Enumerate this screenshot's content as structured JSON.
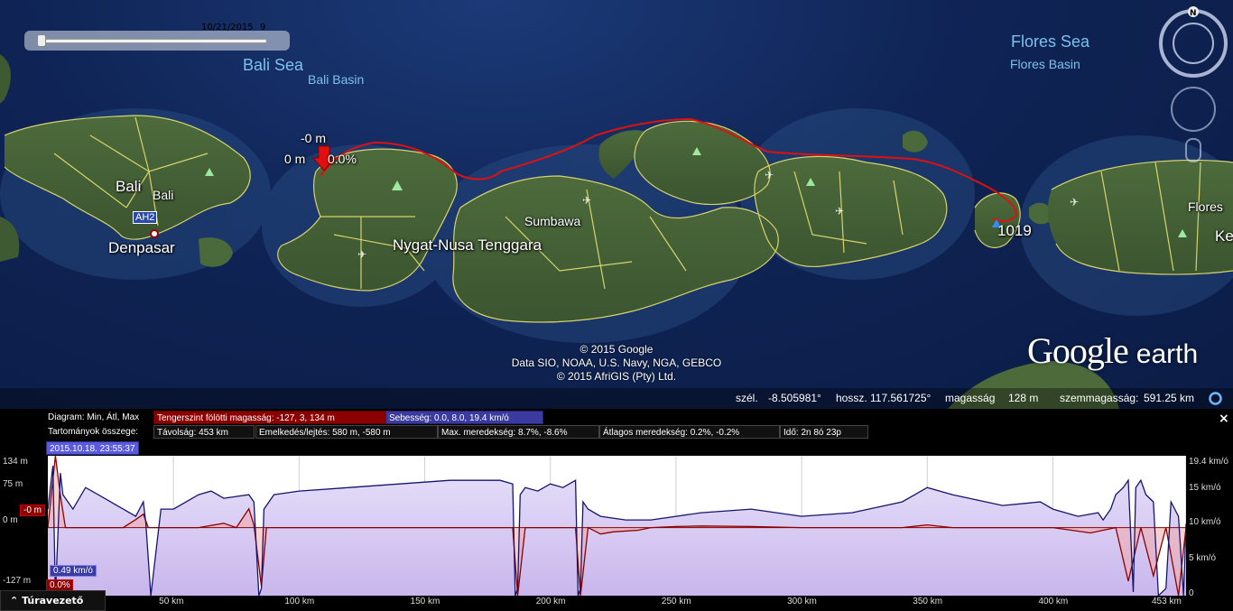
{
  "time_slider": {
    "date": "10/21/2015",
    "value": "9"
  },
  "map_labels": {
    "bali_sea": "Bali Sea",
    "bali_basin": "Bali Basin",
    "flores_sea": "Flores Sea",
    "flores_basin": "Flores Basin",
    "bali_island": "Bali",
    "bali_region": "Bali",
    "ah2": "AH2",
    "denpasar": "Denpasar",
    "sumbawa": "Sumbawa",
    "nygat": "Nygat-Nusa Tenggara",
    "flores": "Flores",
    "ke": "Ke",
    "marker_alt": "-0 m",
    "marker_left": "0 m",
    "marker_pct": "0.0%",
    "end_value": "1019"
  },
  "credits": {
    "line1": "© 2015 Google",
    "line2": "Data SIO, NOAA, U.S. Navy, NGA, GEBCO",
    "line3": "© 2015 AfriGIS (Pty) Ltd."
  },
  "logo": {
    "google": "Google",
    "earth": "earth"
  },
  "status": {
    "lat_label": "szél.",
    "lat": "-8.505981°",
    "lon_label": "hossz.",
    "lon": "117.561725°",
    "elev_label": "magasság",
    "elev": "128 m",
    "eye_label": "szemmagasság:",
    "eye": "591.25 km"
  },
  "profile": {
    "diagram_label": "Diagram: Min, Átl, Max",
    "altitude_stats": "Tengerszint fölötti magasság: -127, 3, 134 m",
    "speed_stats": "Sebesség: 0.0, 8.0, 19.4 km/ó",
    "range_label": "Tartományok összege:",
    "distance": "Távolság: 453 km",
    "gain_loss": "Emelkedés/lejtés: 580 m, -580 m",
    "max_slope": "Max. meredekség: 8.7%, -8.6%",
    "avg_slope": "Átlagos meredekség: 0.2%, -0.2%",
    "duration": "Idő: 2n 8ó 23p",
    "cursor_date": "2015.10.18. 23:55:37",
    "close": "×",
    "y_left": [
      "134 m",
      "75 m",
      "0 m",
      "-127 m"
    ],
    "y_left_current": "-0 m",
    "y_right": [
      "19.4 km/ó",
      "15 km/ó",
      "10 km/ó",
      "5 km/ó",
      "0"
    ],
    "speed_current": "0.49 km/ó",
    "slope_current": "0.0%",
    "x_ticks": [
      "50 km",
      "100 km",
      "150 km",
      "200 km",
      "250 km",
      "300 km",
      "350 km",
      "400 km",
      "453 km"
    ],
    "tour_button": "Túravezető"
  },
  "colors": {
    "track": "#e01010",
    "altitude_line": "#8b0000",
    "speed_line": "#15156e",
    "speed_fill": "#c9b6ec"
  },
  "chart_data": {
    "type": "line",
    "x_unit": "km",
    "xlim": [
      0,
      453
    ],
    "x_ticks": [
      50,
      100,
      150,
      200,
      250,
      300,
      350,
      400,
      453
    ],
    "series": [
      {
        "axis": "left",
        "ylim": [
          -127,
          134
        ],
        "x": [
          0,
          3,
          5,
          7,
          10,
          20,
          30,
          35,
          38,
          40,
          50,
          60,
          70,
          75,
          80,
          82,
          85,
          87,
          90,
          100,
          120,
          150,
          180,
          185,
          187,
          190,
          200,
          210,
          212,
          215,
          220,
          225,
          235,
          240,
          250,
          260,
          280,
          300,
          320,
          340,
          350,
          360,
          380,
          400,
          415,
          420,
          425,
          430,
          435,
          440,
          445,
          450,
          453
        ],
        "y": [
          0,
          134,
          60,
          0,
          0,
          0,
          0,
          15,
          25,
          0,
          0,
          0,
          8,
          0,
          35,
          5,
          -110,
          0,
          0,
          0,
          0,
          0,
          0,
          0,
          -127,
          0,
          0,
          0,
          -127,
          0,
          -12,
          -8,
          -5,
          0,
          2,
          3,
          2,
          0,
          0,
          0,
          5,
          0,
          0,
          0,
          -10,
          -5,
          0,
          -100,
          0,
          -90,
          0,
          -127,
          0
        ]
      },
      {
        "axis": "right",
        "ylim": [
          0,
          19.4
        ],
        "x": [
          0,
          2,
          3,
          5,
          6,
          8,
          10,
          15,
          20,
          25,
          30,
          35,
          38,
          39,
          41,
          45,
          50,
          60,
          65,
          70,
          80,
          82,
          84,
          85,
          86,
          88,
          90,
          100,
          120,
          140,
          160,
          180,
          185,
          186,
          187,
          188,
          190,
          195,
          200,
          205,
          210,
          211,
          212,
          213,
          215,
          220,
          230,
          240,
          250,
          260,
          280,
          300,
          320,
          340,
          350,
          360,
          380,
          395,
          400,
          410,
          418,
          420,
          423,
          425,
          428,
          430,
          432,
          433,
          435,
          437,
          440,
          442,
          445,
          447,
          450,
          452,
          453
        ],
        "y": [
          12,
          18,
          0,
          17,
          14,
          13,
          12,
          15,
          14,
          13,
          12,
          11,
          13,
          10,
          0,
          12,
          12,
          14,
          14.5,
          13.5,
          14,
          13,
          0,
          1,
          12,
          13,
          14,
          14.5,
          15,
          15.5,
          16,
          16,
          15.5,
          0,
          1,
          14,
          15,
          14.5,
          15.5,
          15,
          16,
          0,
          1,
          13,
          12,
          11,
          10.5,
          10.5,
          11,
          11.5,
          12,
          11,
          11.5,
          13,
          15,
          14,
          12.5,
          13,
          12,
          11,
          11.5,
          10.5,
          12,
          14,
          15,
          16,
          0.5,
          15,
          16,
          14,
          13,
          0,
          1,
          13,
          11,
          0,
          10
        ]
      }
    ]
  }
}
